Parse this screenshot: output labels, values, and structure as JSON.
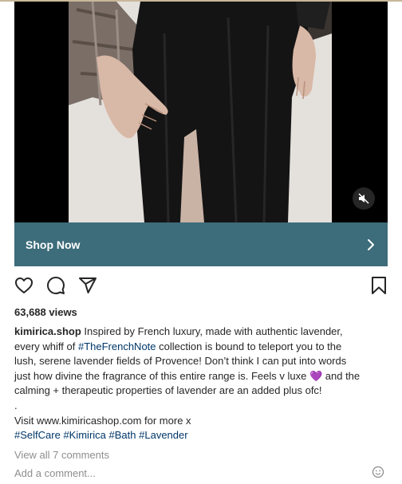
{
  "promo": {
    "shop_label": "Shop Now"
  },
  "stats": {
    "views": "63,688 views"
  },
  "caption": {
    "username": "kimirica.shop",
    "line1": " Inspired by French luxury, made with authentic lavender,",
    "line2_pre": "every whiff of ",
    "line2_tag": "#TheFrenchNote",
    "line2_post": " collection is bound to teleport you to the",
    "line3": "lush, serene lavender fields of Provence! Don’t think I can put into words",
    "line4": "just how divine the fragrance of this entire range is. Feels v luxe 💜 and the",
    "line5": "calming + therapeutic properties of lavender are an added plus ofc!",
    "dot": ".",
    "visit": "Visit www.kimiricashop.com for more x",
    "hashtags": [
      "#SelfCare",
      "#Kimirica",
      "#Bath",
      "#Lavender"
    ]
  },
  "comments": {
    "view_all": "View all 7 comments",
    "add_placeholder": "Add a comment..."
  },
  "colors": {
    "shop_bar": "#3d6c7a",
    "hashtag": "#00376b",
    "muted_text": "#8e8e8e"
  },
  "icons": [
    "heart-icon",
    "comment-icon",
    "share-icon",
    "bookmark-icon",
    "mute-icon",
    "chevron-right-icon",
    "emoji-icon"
  ]
}
